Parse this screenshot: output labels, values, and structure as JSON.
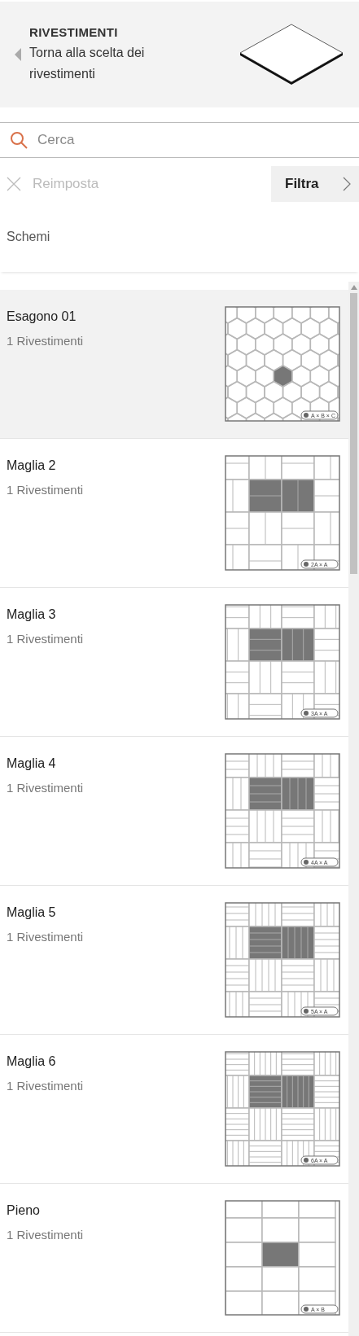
{
  "header": {
    "title": "RIVESTIMENTI",
    "subtitle": "Torna alla scelta dei rivestimenti"
  },
  "search": {
    "placeholder": "Cerca"
  },
  "reset": {
    "label": "Reimposta",
    "disabled": true
  },
  "filter": {
    "label": "Filtra"
  },
  "section": {
    "title": "Schemi"
  },
  "schemes": [
    {
      "name": "Esagono 01",
      "count": "1 Rivestimenti",
      "kind": "hexagon",
      "legend": "A × B × C",
      "selected": true
    },
    {
      "name": "Maglia 2",
      "count": "1 Rivestimenti",
      "kind": "weave2",
      "legend": "2A × A",
      "selected": false
    },
    {
      "name": "Maglia 3",
      "count": "1 Rivestimenti",
      "kind": "weave3",
      "legend": "3A × A",
      "selected": false
    },
    {
      "name": "Maglia 4",
      "count": "1 Rivestimenti",
      "kind": "weave4",
      "legend": "4A × A",
      "selected": false
    },
    {
      "name": "Maglia 5",
      "count": "1 Rivestimenti",
      "kind": "weave5",
      "legend": "5A × A",
      "selected": false
    },
    {
      "name": "Maglia 6",
      "count": "1 Rivestimenti",
      "kind": "weave6",
      "legend": "6A × A",
      "selected": false
    },
    {
      "name": "Pieno",
      "count": "1 Rivestimenti",
      "kind": "grid",
      "legend": "A × B",
      "selected": false
    }
  ]
}
